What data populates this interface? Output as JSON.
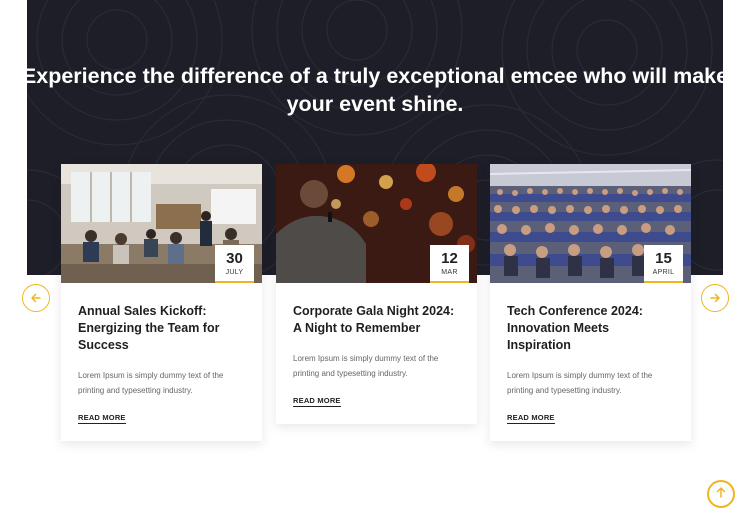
{
  "hero": {
    "headline_line1": "Experience the difference of a truly exceptional emcee who will make",
    "headline_line2": "your event shine."
  },
  "events": [
    {
      "day": "30",
      "month": "JULY",
      "title": "Annual Sales Kickoff: Energizing the Team for Success",
      "excerpt": "Lorem Ipsum is simply dummy text of the printing and typesetting industry.",
      "read_more": "READ MORE"
    },
    {
      "day": "12",
      "month": "MAR",
      "title": "Corporate Gala Night 2024: A Night to Remember",
      "excerpt": "Lorem Ipsum is simply dummy text of the printing and typesetting industry.",
      "read_more": "READ MORE"
    },
    {
      "day": "15",
      "month": "APRIL",
      "title": "Tech Conference 2024: Innovation Meets Inspiration",
      "excerpt": "Lorem Ipsum is simply dummy text of the printing and typesetting industry.",
      "read_more": "READ MORE"
    }
  ],
  "controls": {
    "prev_icon": "arrow-left-icon",
    "next_icon": "arrow-right-icon",
    "scroll_top_icon": "arrow-up-icon"
  },
  "colors": {
    "accent": "#f0b51e",
    "hero_bg": "#1d1e27",
    "heading": "#1f1f1f",
    "body_text": "#666666"
  }
}
